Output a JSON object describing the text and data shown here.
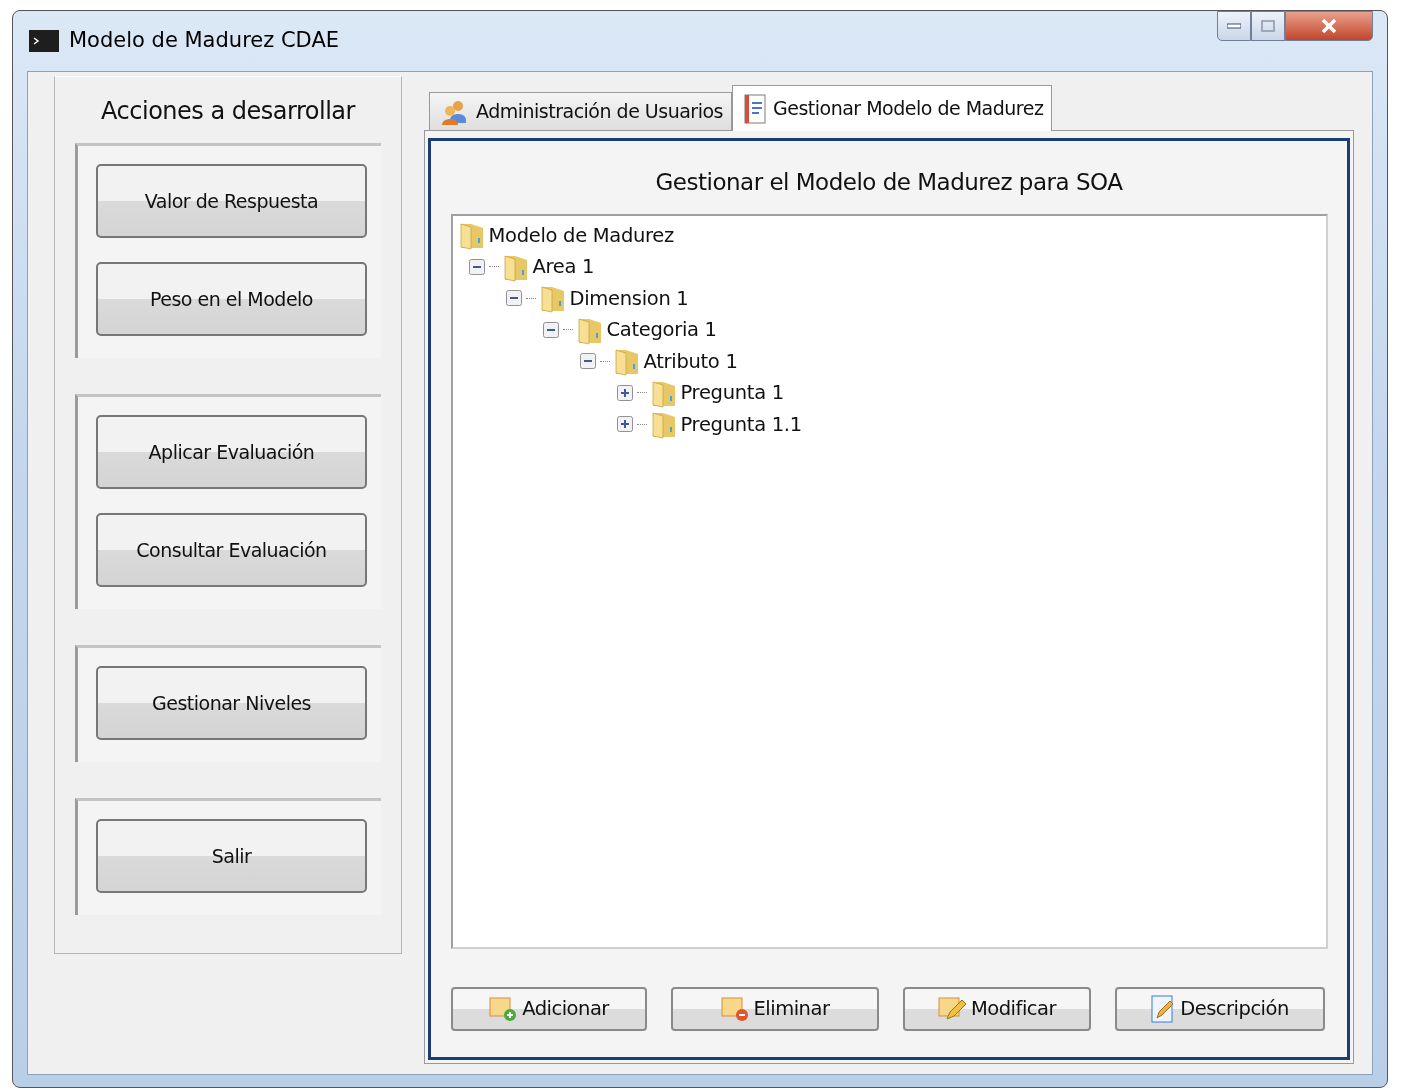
{
  "window": {
    "title": "Modelo de Madurez CDAE"
  },
  "actions": {
    "title": "Acciones a desarrollar",
    "groups": [
      {
        "buttons": [
          "Valor de Respuesta",
          "Peso en el Modelo"
        ]
      },
      {
        "buttons": [
          "Aplicar Evaluación",
          "Consultar Evaluación"
        ]
      },
      {
        "buttons": [
          "Gestionar Niveles"
        ]
      },
      {
        "buttons": [
          "Salir"
        ]
      }
    ]
  },
  "tabs": [
    {
      "label": "Administración de Usuarios",
      "kind": "users",
      "selected": false
    },
    {
      "label": "Gestionar Modelo de Madurez",
      "kind": "document",
      "selected": true
    }
  ],
  "panel": {
    "title": "Gestionar el Modelo de Madurez para SOA",
    "tree": [
      {
        "label": "Modelo de Madurez",
        "children": [
          {
            "label": "Area 1",
            "expanded": true,
            "children": [
              {
                "label": "Dimension 1",
                "expanded": true,
                "children": [
                  {
                    "label": "Categoria 1",
                    "expanded": true,
                    "children": [
                      {
                        "label": "Atributo 1",
                        "expanded": true,
                        "children": [
                          {
                            "label": "Pregunta 1",
                            "expanded": false
                          },
                          {
                            "label": "Pregunta 1.1",
                            "expanded": false
                          }
                        ]
                      }
                    ]
                  }
                ]
              }
            ]
          }
        ]
      }
    ]
  },
  "buttons": [
    {
      "label": "Adicionar",
      "kind": "add"
    },
    {
      "label": "Eliminar",
      "kind": "remove"
    },
    {
      "label": "Modificar",
      "kind": "edit"
    },
    {
      "label": "Descripción",
      "kind": "describe"
    }
  ]
}
